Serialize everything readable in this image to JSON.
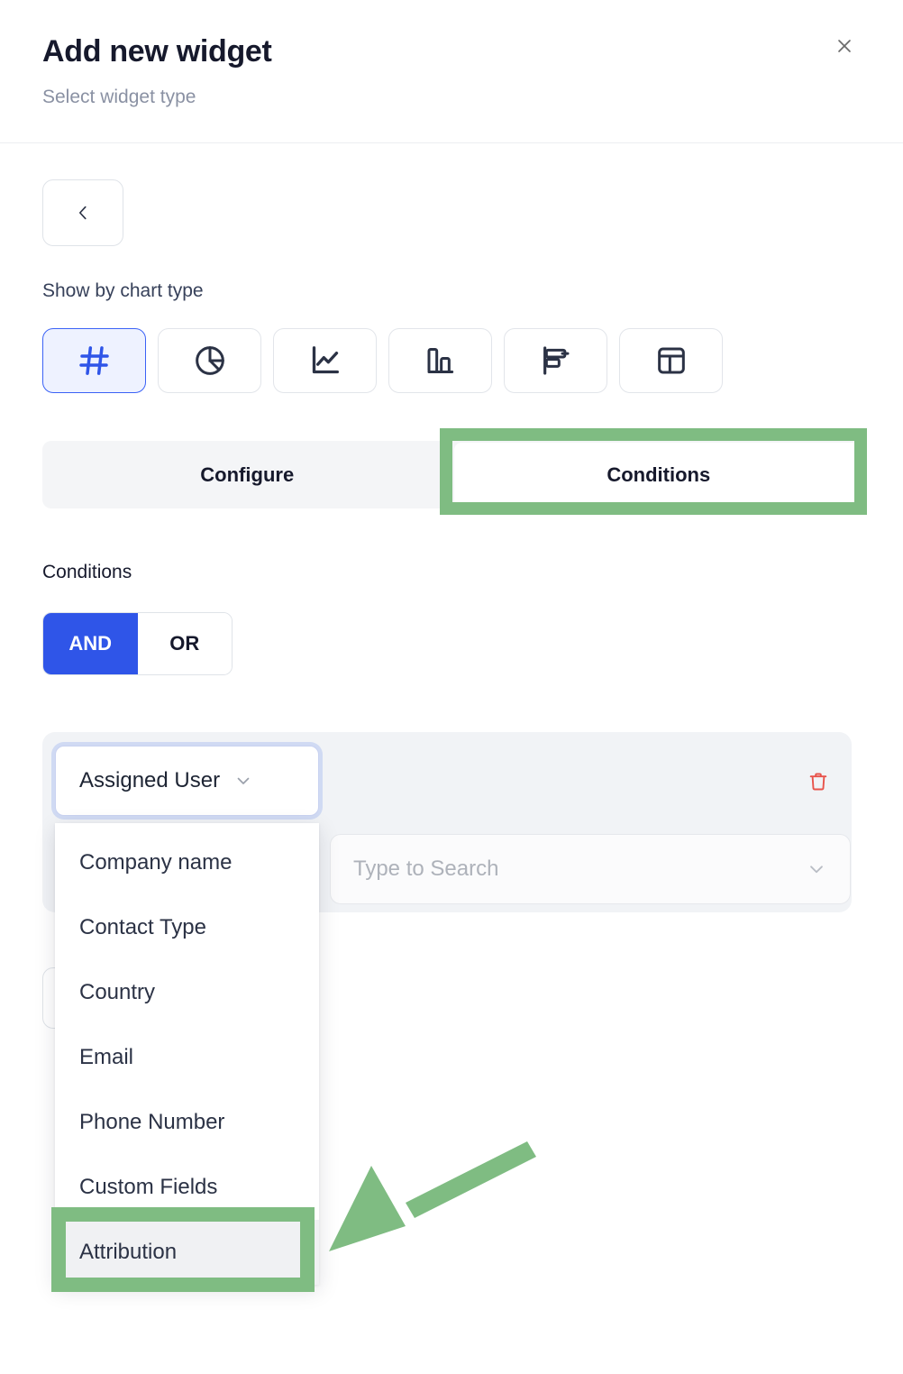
{
  "header": {
    "title": "Add new widget",
    "subtitle": "Select widget type",
    "close_icon": "close-icon"
  },
  "nav": {
    "back_icon": "chevron-left-icon"
  },
  "chart_type_section": {
    "label": "Show by chart type",
    "options": [
      {
        "name": "number-chart",
        "icon": "hash-icon",
        "selected": true
      },
      {
        "name": "pie-chart",
        "icon": "pie-chart-icon",
        "selected": false
      },
      {
        "name": "line-chart",
        "icon": "line-chart-icon",
        "selected": false
      },
      {
        "name": "column-chart",
        "icon": "bar-chart-vertical-icon",
        "selected": false
      },
      {
        "name": "bar-chart",
        "icon": "bar-chart-horizontal-icon",
        "selected": false
      },
      {
        "name": "table-chart",
        "icon": "table-icon",
        "selected": false
      }
    ]
  },
  "tabs": [
    {
      "label": "Configure",
      "active": false
    },
    {
      "label": "Conditions",
      "active": true
    }
  ],
  "conditions": {
    "label": "Conditions",
    "logic": {
      "and_label": "AND",
      "or_label": "OR",
      "selected": "AND"
    },
    "row": {
      "field_value": "Assigned User",
      "field_caret_icon": "chevron-down-icon",
      "value_placeholder": "Type to Search",
      "value_caret_icon": "chevron-down-icon",
      "delete_icon": "trash-icon"
    },
    "dropdown_options": [
      {
        "label": "Company name",
        "highlighted": false
      },
      {
        "label": "Contact Type",
        "highlighted": false
      },
      {
        "label": "Country",
        "highlighted": false
      },
      {
        "label": "Email",
        "highlighted": false
      },
      {
        "label": "Phone Number",
        "highlighted": false
      },
      {
        "label": "Custom Fields",
        "highlighted": false
      },
      {
        "label": "Attribution",
        "highlighted": true
      }
    ]
  },
  "annotations": {
    "color": "#7fbc82",
    "highlight_tab": "Conditions",
    "highlight_option": "Attribution",
    "arrow_icon": "arrow-pointing-left-down-icon"
  },
  "colors": {
    "accent_blue": "#2f55e8",
    "selected_chart_border": "#3b62f6",
    "selected_chart_bg": "#eef2ff",
    "danger_red": "#e8534b",
    "annotation_green": "#7fbc82",
    "card_bg": "#f1f3f6",
    "tabbar_bg": "#f4f5f7"
  }
}
